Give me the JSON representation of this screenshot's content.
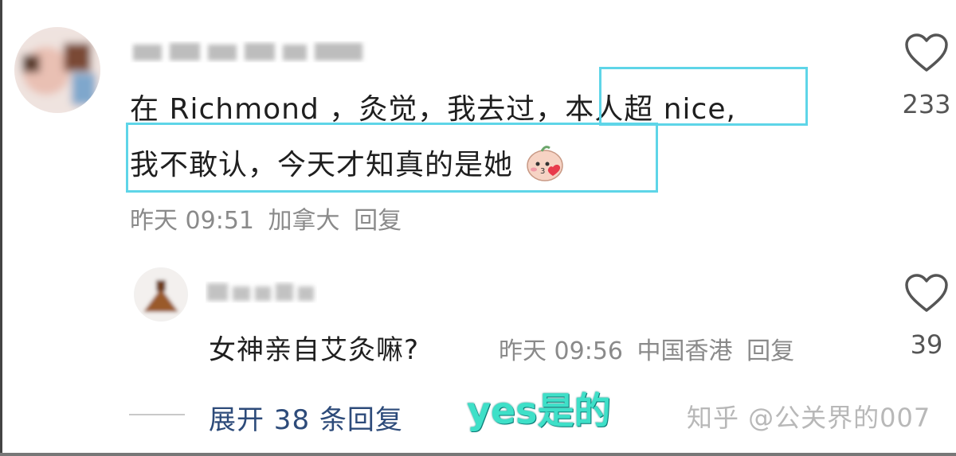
{
  "comment": {
    "text_line1": "在 Richmond ，灸觉，我去过，本人超 nice,",
    "text_line2": "我不敢认，今天才知真的是她",
    "time": "昨天 09:51",
    "location": "加拿大",
    "reply_label": "回复",
    "like_count": "233"
  },
  "reply": {
    "text": "女神亲自艾灸嘛?",
    "time": "昨天 09:56",
    "location": "中国香港",
    "reply_label": "回复",
    "like_count": "39"
  },
  "expand": {
    "label": "展开 38 条回复"
  },
  "overlay": {
    "text": "yes是的"
  },
  "watermark": {
    "text": "知乎 @公关界的007"
  },
  "colors": {
    "highlight": "#5ed5e8",
    "overlay_text": "#3ee0c8",
    "meta": "#8a8a8a",
    "expand_link": "#2d4b7a"
  },
  "icons": {
    "like": "heart-outline-icon",
    "emoji": "blushing-face-emoji-icon"
  }
}
